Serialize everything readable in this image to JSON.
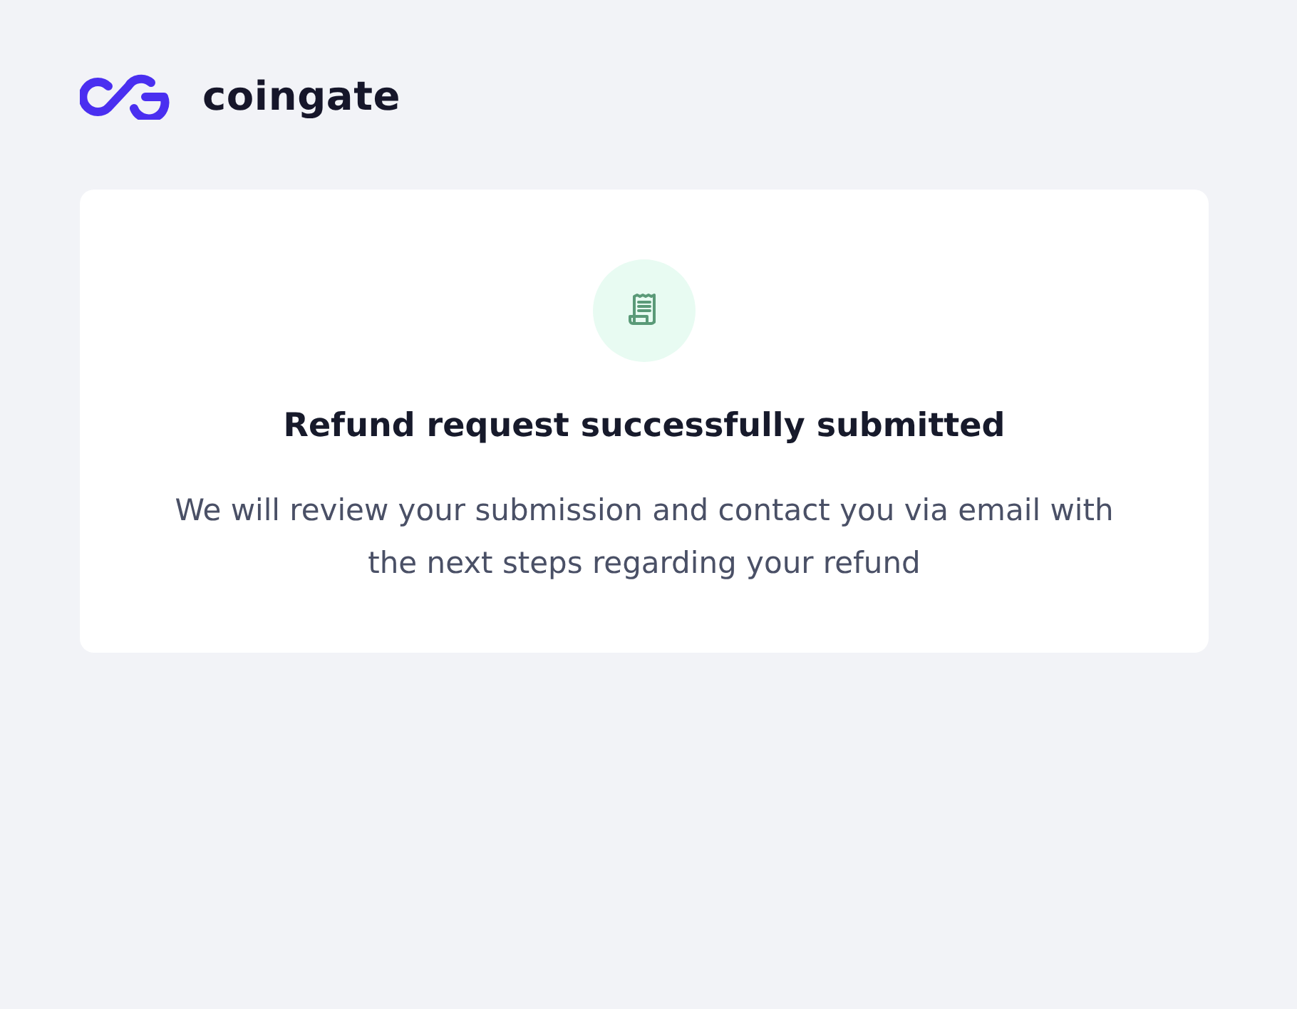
{
  "header": {
    "logo_text": "coingate"
  },
  "card": {
    "title": "Refund request successfully submitted",
    "message": "We will review your submission and contact you via email with the next steps regarding your refund"
  }
}
